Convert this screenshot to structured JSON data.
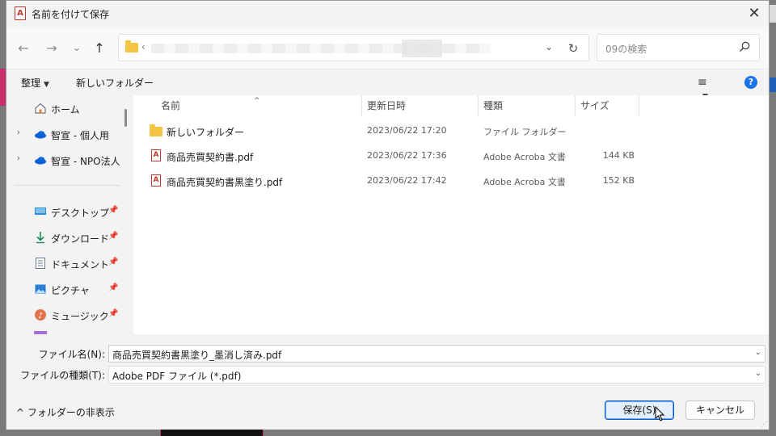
{
  "dialog": {
    "title": "名前を付けて保存",
    "close_glyph": "✕"
  },
  "nav": {
    "back_glyph": "←",
    "forward_glyph": "→",
    "recent_glyph": "⌄",
    "up_glyph": "↑",
    "address_chevron": "‹",
    "address_dropdown_glyph": "⌄",
    "refresh_glyph": "↻",
    "search_placeholder": "09の検索"
  },
  "toolbar": {
    "organize_label": "整理",
    "organize_caret": "▼",
    "new_folder_label": "新しいフォルダー",
    "view_glyph": "≡",
    "view_caret": "▼",
    "help_glyph": "?"
  },
  "navpane": {
    "items": [
      {
        "label": "ホーム",
        "icon": "home-icon",
        "arrow": ""
      },
      {
        "label": "智宣 - 個人用",
        "icon": "onedrive-icon",
        "arrow": "›"
      },
      {
        "label": "智宣 - NPO法人",
        "icon": "onedrive-icon",
        "arrow": "›"
      },
      {
        "label": "デスクトップ",
        "icon": "desktop-icon",
        "pin": "📌"
      },
      {
        "label": "ダウンロード",
        "icon": "download-icon",
        "pin": "📌"
      },
      {
        "label": "ドキュメント",
        "icon": "documents-icon",
        "pin": "📌"
      },
      {
        "label": "ピクチャ",
        "icon": "pictures-icon",
        "pin": "📌"
      },
      {
        "label": "ミュージック",
        "icon": "music-icon",
        "pin": "📌"
      }
    ]
  },
  "filelist": {
    "sort_caret": "^",
    "columns": {
      "name": "名前",
      "date": "更新日時",
      "type": "種類",
      "size": "サイズ"
    },
    "rows": [
      {
        "name": "新しいフォルダー",
        "date": "2023/06/22 17:20",
        "type": "ファイル フォルダー",
        "size": "",
        "icon": "folder-icon"
      },
      {
        "name": "商品売買契約書.pdf",
        "date": "2023/06/22 17:36",
        "type": "Adobe Acroba 文書",
        "size": "144 KB",
        "icon": "pdf-icon"
      },
      {
        "name": "商品売買契約書黒塗り.pdf",
        "date": "2023/06/22 17:42",
        "type": "Adobe Acroba 文書",
        "size": "152 KB",
        "icon": "pdf-icon"
      }
    ]
  },
  "form": {
    "filename_label": "ファイル名(N):",
    "filename_value": "商品売買契約書黒塗り_墨消し済み.pdf",
    "filetype_label": "ファイルの種類(T):",
    "filetype_value": "Adobe PDF ファイル (*.pdf)",
    "dropdown_glyph": "⌄"
  },
  "footer": {
    "toggle_label": "^  フォルダーの非表示",
    "save_label": "保存(S)",
    "cancel_label": "キャンセル"
  }
}
